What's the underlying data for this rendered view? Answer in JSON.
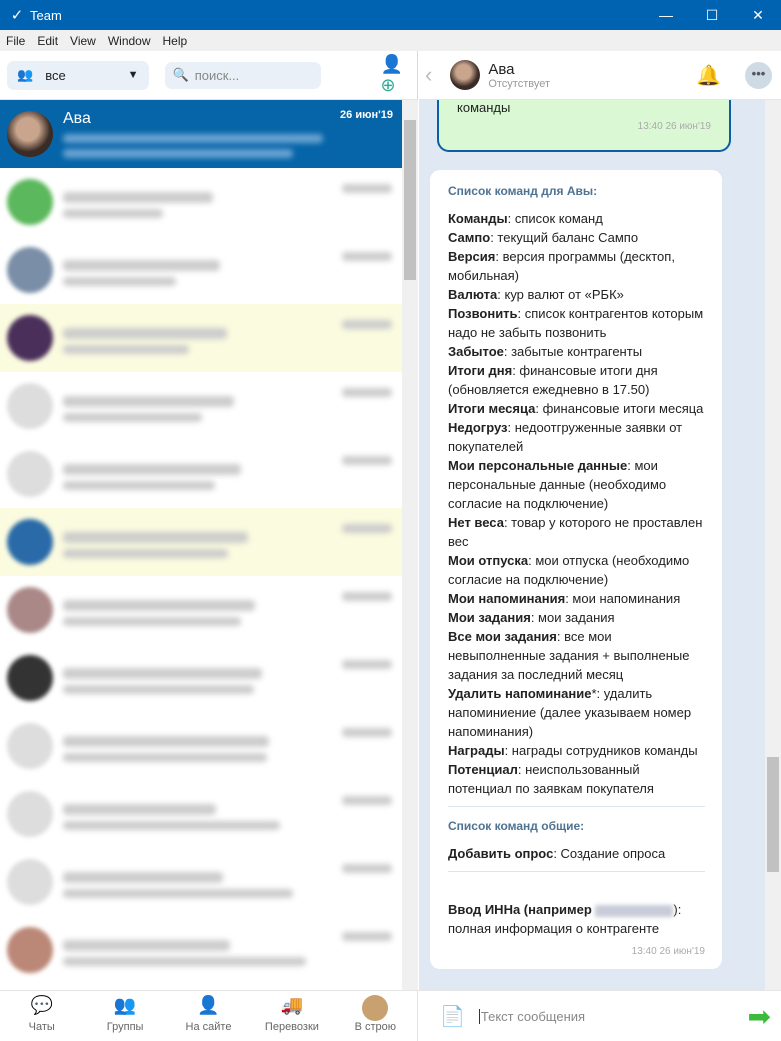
{
  "window": {
    "title": "Team",
    "logo": "✓",
    "controls": [
      "—",
      "☐",
      "✕"
    ]
  },
  "menu": [
    "File",
    "Edit",
    "View",
    "Window",
    "Help"
  ],
  "sidebar": {
    "filter": "все",
    "search_placeholder": "поиск...",
    "selected": {
      "name": "Ава",
      "date": "26 июн'19"
    },
    "other_rows": 12
  },
  "chat_header": {
    "name": "Ава",
    "status": "Отсутствует"
  },
  "messages": {
    "outgoing": {
      "text": "команды",
      "time": "13:40 26 июн'19"
    },
    "incoming": {
      "header": "Список команд для Авы:",
      "commands": [
        {
          "b": "Команды",
          "t": ": список команд"
        },
        {
          "b": "Сампо",
          "t": ": текущий баланс Сампо"
        },
        {
          "b": "Версия",
          "t": ": версия программы (десктоп, мобильная)"
        },
        {
          "b": "Валюта",
          "t": ": кур валют от «РБК»"
        },
        {
          "b": "Позвонить",
          "t": ": список контрагентов которым надо не забыть позвонить"
        },
        {
          "b": "Забытое",
          "t": ": забытые контрагенты"
        },
        {
          "b": "Итоги дня",
          "t": ": финансовые итоги дня (обновляется ежедневно в 17.50)"
        },
        {
          "b": "Итоги месяца",
          "t": ": финансовые итоги месяца"
        },
        {
          "b": "Недогруз",
          "t": ": недоотгруженные заявки от покупателей"
        },
        {
          "b": "Мои персональные данные",
          "t": ": мои персональные данные (необходимо согласие на подключение)"
        },
        {
          "b": "Нет веса",
          "t": ": товар у которого не проставлен вес"
        },
        {
          "b": "Мои отпуска",
          "t": ": мои отпуска (необходимо согласие на подключение)"
        },
        {
          "b": "Мои напоминания",
          "t": ": мои напоминания"
        },
        {
          "b": "Мои задания",
          "t": ": мои задания"
        },
        {
          "b": "Все мои задания",
          "t": ": все мои невыполненные задания + выполненые задания за последний месяц"
        },
        {
          "b": "Удалить напоминание",
          "t": "*: удалить напоминиение (далее указываем номер напоминания)"
        },
        {
          "b": "Награды",
          "t": ": награды сотрудников команды"
        },
        {
          "b": "Потенциал",
          "t": ": неиспользованный потенциал по заявкам покупателя"
        }
      ],
      "common_header": "Список команд общие:",
      "common": [
        {
          "b": "Добавить опрос",
          "t": ": Создание опроса"
        }
      ],
      "inn_bold": "Ввод ИННа (например ",
      "inn_tail": "):",
      "inn_desc": "полная информация о контрагенте",
      "time": "13:40 26 июн'19"
    }
  },
  "bottom_nav": [
    "Чаты",
    "Группы",
    "На сайте",
    "Перевозки",
    "В строю"
  ],
  "compose": {
    "placeholder": "Текст сообщения"
  }
}
